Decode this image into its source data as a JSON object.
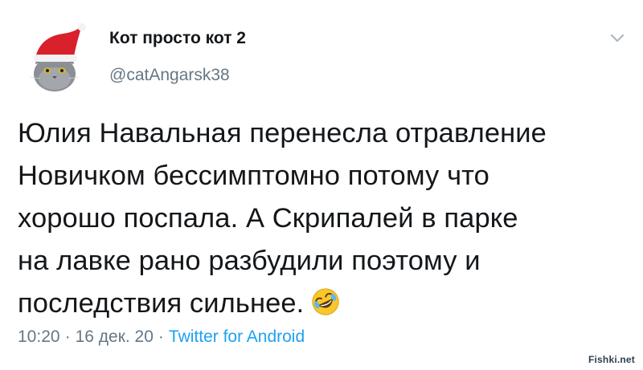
{
  "tweet": {
    "author_name": "Кот просто кот 2",
    "author_handle": "@catAngarsk38",
    "body_lines": [
      "Юлия Навальная перенесла отравление",
      "Новичком бессимптомно потому что",
      "хорошо поспала. А Скрипалей в парке",
      "на лавке рано разбудили поэтому и",
      "последствия сильнее."
    ],
    "emoji": "rolling-on-the-floor-laughing-icon",
    "time": "10:20",
    "date": "16 дек. 20",
    "source": "Twitter for Android",
    "separator": "·"
  },
  "icons": {
    "avatar": "cat-with-santa-hat-avatar",
    "menu": "chevron-down-icon"
  },
  "watermark": "Fishki.net",
  "colors": {
    "text": "#14171a",
    "secondary": "#657786",
    "link": "#1da1f2"
  }
}
